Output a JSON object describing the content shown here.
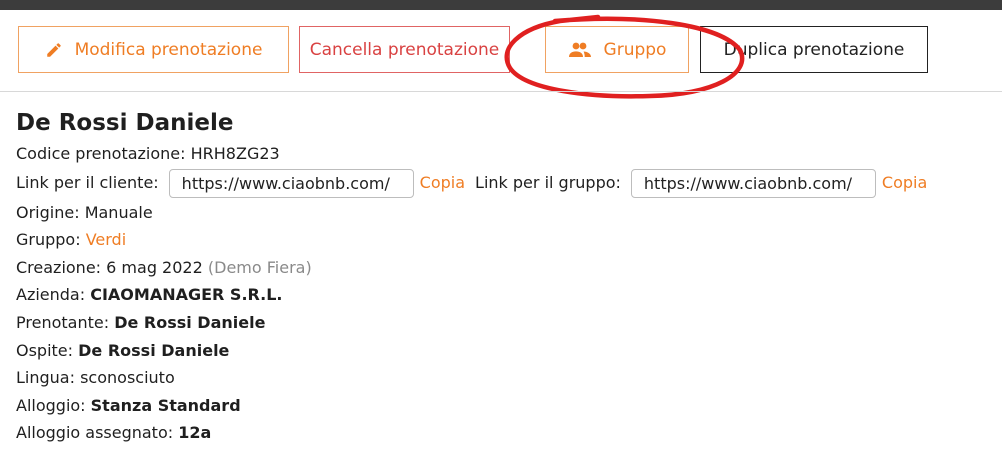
{
  "toolbar": {
    "edit_label": "Modifica prenotazione",
    "cancel_label": "Cancella prenotazione",
    "group_label": "Gruppo",
    "duplicate_label": "Duplica prenotazione"
  },
  "booking": {
    "name": "De Rossi Daniele",
    "code_label": "Codice prenotazione:",
    "code": "HRH8ZG23",
    "client_link_label": "Link per il cliente:",
    "client_link": "https://www.ciaobnb.com/",
    "copy_label": "Copia",
    "group_link_label": "Link per il gruppo:",
    "group_link": "https://www.ciaobnb.com/",
    "origin_label": "Origine:",
    "origin": "Manuale",
    "group_label": "Gruppo:",
    "group": "Verdi",
    "created_label": "Creazione:",
    "created": "6 mag 2022",
    "created_by": "(Demo Fiera)",
    "company_label": "Azienda:",
    "company": "CIAOMANAGER S.R.L.",
    "booker_label": "Prenotante:",
    "booker": "De Rossi Daniele",
    "guest_label": "Ospite:",
    "guest": "De Rossi Daniele",
    "language_label": "Lingua:",
    "language": "sconosciuto",
    "accommodation_label": "Alloggio:",
    "accommodation": "Stanza Standard",
    "assigned_label": "Alloggio assegnato:",
    "assigned": "12a"
  },
  "colors": {
    "accent": "#ef7d24",
    "danger": "#d94242",
    "annotation": "#e02020"
  },
  "icons": {
    "edit": "pencil-icon",
    "group": "people-icon"
  }
}
